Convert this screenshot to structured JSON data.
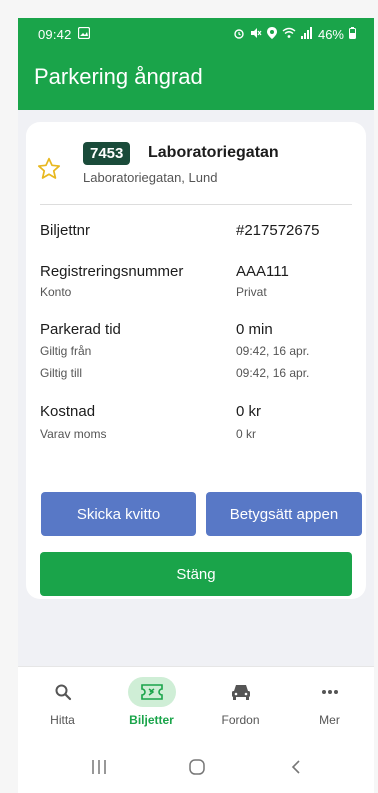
{
  "status": {
    "time": "09:42",
    "battery": "46%"
  },
  "appbar": {
    "title": "Parkering ångrad"
  },
  "zone": {
    "code": "7453",
    "name": "Laboratoriegatan",
    "address": "Laboratoriegatan, Lund"
  },
  "ticket": {
    "ticket_label": "Biljettnr",
    "ticket_value": "#217572675",
    "reg_label": "Registreringsnummer",
    "reg_value": "AAA111",
    "account_label": "Konto",
    "account_value": "Privat",
    "parked_label": "Parkerad tid",
    "parked_value": "0 min",
    "from_label": "Giltig från",
    "from_value": "09:42, 16 apr.",
    "to_label": "Giltig till",
    "to_value": "09:42, 16 apr.",
    "cost_label": "Kostnad",
    "cost_value": "0 kr",
    "vat_label": "Varav moms",
    "vat_value": "0 kr"
  },
  "actions": {
    "send_receipt": "Skicka kvitto",
    "rate_app": "Betygsätt appen",
    "close": "Stäng"
  },
  "nav": {
    "items": [
      {
        "label": "Hitta",
        "icon": "search-icon"
      },
      {
        "label": "Biljetter",
        "icon": "ticket-icon"
      },
      {
        "label": "Fordon",
        "icon": "car-icon"
      },
      {
        "label": "Mer",
        "icon": "more-icon"
      }
    ]
  },
  "colors": {
    "brand_green": "#1aa44a",
    "button_blue": "#5878c6",
    "badge_dark": "#1a4b3a",
    "star_yellow": "#e8b820"
  }
}
